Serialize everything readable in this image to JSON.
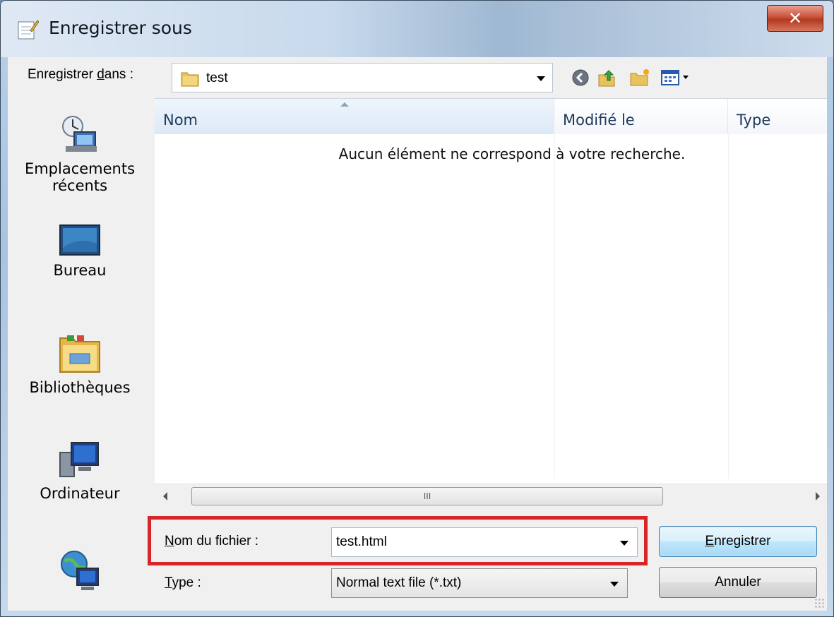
{
  "window": {
    "title": "Enregistrer sous"
  },
  "toolbar": {
    "save_in_label_pre": "Enregistrer ",
    "save_in_label_mn": "d",
    "save_in_label_post": "ans :",
    "folder_name": "test",
    "icons": [
      "back-icon",
      "up-folder-icon",
      "new-folder-icon",
      "views-menu-icon"
    ]
  },
  "places": {
    "items": [
      {
        "label": "Emplacements récents",
        "icon": "recent-places-icon"
      },
      {
        "label": "Bureau",
        "icon": "desktop-icon"
      },
      {
        "label": "Bibliothèques",
        "icon": "libraries-icon"
      },
      {
        "label": "Ordinateur",
        "icon": "computer-icon"
      },
      {
        "label": "",
        "icon": "network-icon"
      }
    ]
  },
  "list": {
    "columns": [
      "Nom",
      "Modifié le",
      "Type"
    ],
    "empty_message": "Aucun élément ne correspond à votre recherche.",
    "scroll_thumb_glyph": "III"
  },
  "filename": {
    "label_mn": "N",
    "label_rest": "om du fichier :",
    "value": "test.html"
  },
  "filetype": {
    "label_mn": "T",
    "label_rest": "ype :",
    "value": "Normal text file (*.txt)"
  },
  "buttons": {
    "save_mn": "E",
    "save_rest": "nregistrer",
    "cancel": "Annuler"
  },
  "colors": {
    "highlight": "#d8252a",
    "close_button": "#c9523a"
  }
}
